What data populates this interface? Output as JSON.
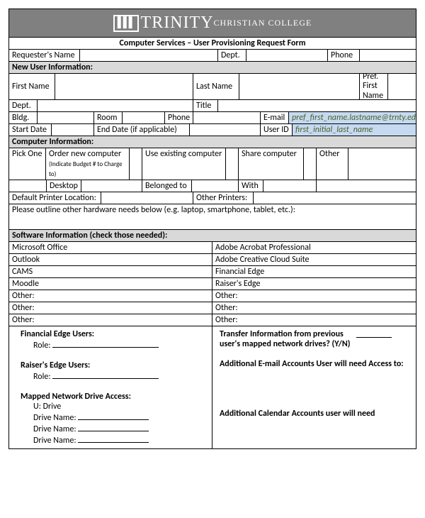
{
  "header": {
    "brand_main": "TRINITY",
    "brand_sub": "CHRISTIAN COLLEGE",
    "form_title": "Computer Services – User Provisioning Request Form"
  },
  "requester": {
    "name_label": "Requester's Name",
    "dept_label": "Dept.",
    "phone_label": "Phone"
  },
  "sections": {
    "new_user": "New User Information:",
    "computer": "Computer Information:",
    "software": "Software Information (check those needed):"
  },
  "new_user": {
    "first_name": "First Name",
    "last_name": "Last Name",
    "pref_first": "Pref. First Name",
    "dept": "Dept.",
    "title": "Title",
    "bldg": "Bldg.",
    "room": "Room",
    "phone": "Phone",
    "email": "E-mail",
    "email_hint": "pref_first_name.lastname@trnty.edu",
    "start_date": "Start Date",
    "end_date": "End Date (if applicable)",
    "user_id": "User ID",
    "user_id_hint": "first_initial_last_name"
  },
  "computer": {
    "pick_one": "Pick One",
    "order_new": "Order new computer",
    "order_new_sub": "(Indicate Budget # to Charge to)",
    "use_existing": "Use existing computer",
    "share": "Share computer",
    "other": "Other",
    "desktop": "Desktop",
    "belonged_to": "Belonged to",
    "with": "With",
    "default_printer": "Default Printer Location:",
    "other_printers": "Other Printers:",
    "hardware_needs": "Please outline other hardware needs below (e.g. laptop, smartphone, tablet, etc.):"
  },
  "software": {
    "left": [
      "Microsoft Office",
      "Outlook",
      "CAMS",
      "Moodle",
      "Other:",
      "Other:",
      "Other:"
    ],
    "right": [
      "Adobe Acrobat Professional",
      "Adobe Creative Cloud Suite",
      "Financial Edge",
      "Raiser's Edge",
      "Other:",
      "Other:",
      "Other:"
    ]
  },
  "notes": {
    "fe_users": "Financial Edge Users:",
    "role": "Role:",
    "re_users": "Raiser's Edge Users:",
    "mapped": "Mapped Network Drive Access:",
    "u_drive": "U: Drive",
    "drive_name": "Drive Name:",
    "transfer": "Transfer Information from previous user's mapped network drives? (Y/N)",
    "add_email": "Additional E-mail Accounts User will need Access to:",
    "add_cal": "Additional Calendar Accounts user will need"
  }
}
